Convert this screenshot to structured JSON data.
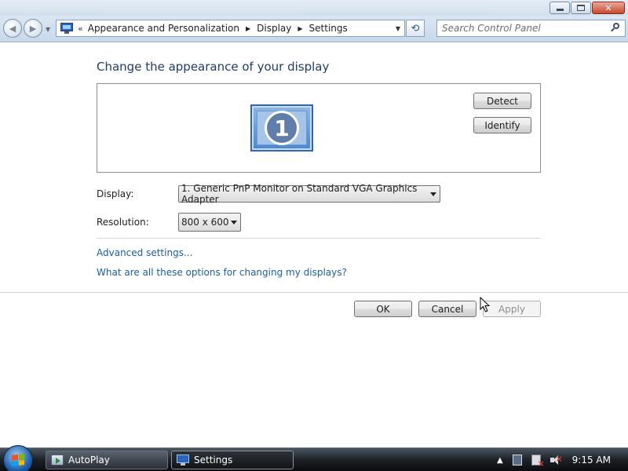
{
  "window": {
    "controls": {
      "minimize": "minimize",
      "maximize": "maximize",
      "close": "close"
    }
  },
  "address_bar": {
    "prefix": "«",
    "breadcrumbs": [
      "Appearance and Personalization",
      "Display",
      "Settings"
    ]
  },
  "search": {
    "placeholder": "Search Control Panel"
  },
  "main": {
    "title": "Change the appearance of your display",
    "monitor_number": "1",
    "detect_label": "Detect",
    "identify_label": "Identify",
    "display_label": "Display:",
    "display_value": "1. Generic PnP Monitor on Standard VGA Graphics Adapter",
    "resolution_label": "Resolution:",
    "resolution_value": "800 x 600",
    "advanced_link": "Advanced settings...",
    "help_link": "What are all these options for changing my displays?"
  },
  "dialog_buttons": {
    "ok": "OK",
    "cancel": "Cancel",
    "apply": "Apply"
  },
  "taskbar": {
    "items": [
      {
        "label": "AutoPlay",
        "icon": "autoplay-icon",
        "active": false
      },
      {
        "label": "Settings",
        "icon": "display-settings-icon",
        "active": true
      }
    ],
    "clock": "9:15 AM"
  },
  "colors": {
    "title_text": "#1e3d6b",
    "link": "#1b5ea7",
    "taskbar": "#1d2127",
    "flag_red": "#f25022",
    "flag_green": "#7fba00",
    "flag_blue": "#00a4ef",
    "flag_yellow": "#ffb900"
  }
}
